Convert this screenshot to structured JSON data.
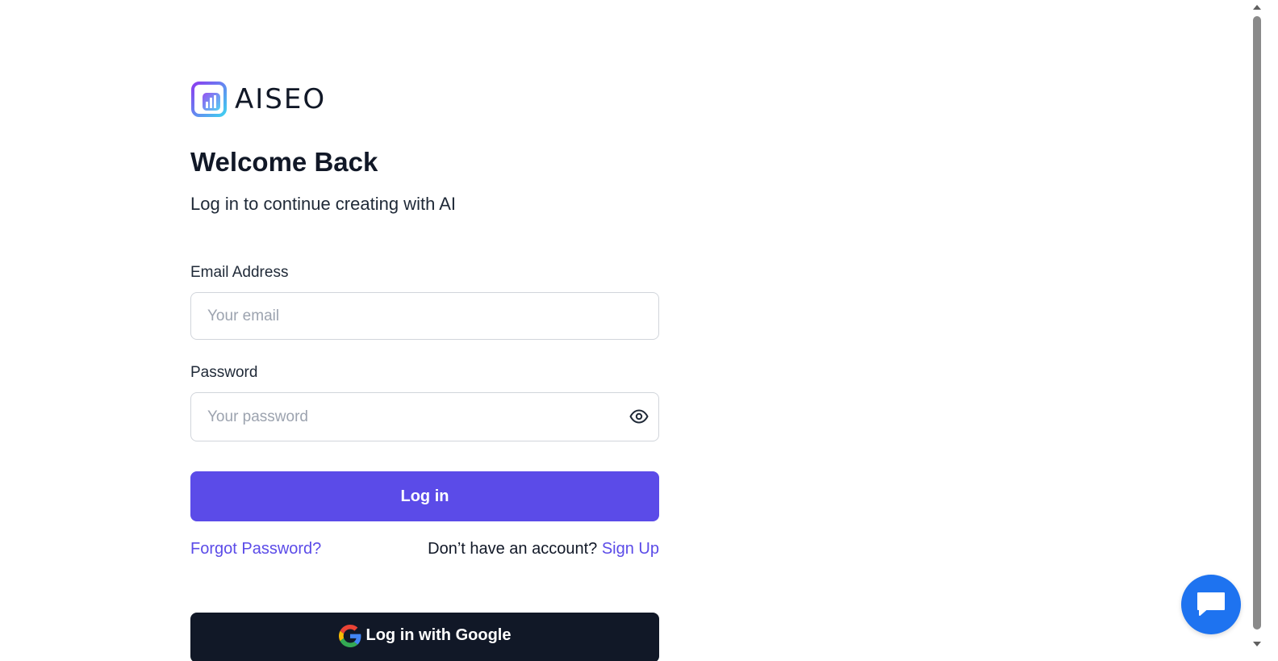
{
  "brand": {
    "name": "AISEO",
    "icon": "aiseo-logo-icon"
  },
  "heading": {
    "title": "Welcome Back",
    "subtitle": "Log in to continue creating with AI"
  },
  "form": {
    "email": {
      "label": "Email Address",
      "placeholder": "Your email",
      "value": ""
    },
    "password": {
      "label": "Password",
      "placeholder": "Your password",
      "value": "",
      "toggle_icon": "eye-icon"
    },
    "submit_label": "Log in"
  },
  "links": {
    "forgot_password": "Forgot Password?",
    "no_account_text": "Don’t have an account?",
    "sign_up": "Sign Up"
  },
  "google": {
    "label": "Log in with Google",
    "icon": "google-icon"
  },
  "chat_widget": {
    "icon": "chat-bubble-icon"
  },
  "colors": {
    "primary": "#5b4be8",
    "dark_button": "#111827",
    "chat_widget": "#1e73f0",
    "text": "#111827",
    "input_border": "#d1d5db",
    "placeholder": "#9ca3af"
  }
}
